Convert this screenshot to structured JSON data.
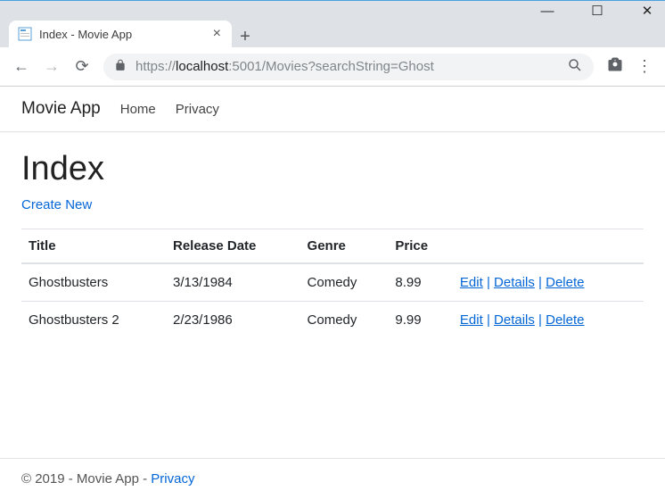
{
  "browser": {
    "tab_title": "Index - Movie App",
    "url_scheme": "https://",
    "url_host": "localhost",
    "url_port": ":5001",
    "url_path": "/Movies?searchString=Ghost"
  },
  "nav": {
    "brand": "Movie App",
    "links": [
      "Home",
      "Privacy"
    ]
  },
  "page": {
    "heading": "Index",
    "create_link": "Create New"
  },
  "table": {
    "headers": [
      "Title",
      "Release Date",
      "Genre",
      "Price",
      ""
    ],
    "rows": [
      {
        "title": "Ghostbusters",
        "release": "3/13/1984",
        "genre": "Comedy",
        "price": "8.99"
      },
      {
        "title": "Ghostbusters 2",
        "release": "2/23/1986",
        "genre": "Comedy",
        "price": "9.99"
      }
    ],
    "actions": {
      "edit": "Edit",
      "details": "Details",
      "delete": "Delete"
    }
  },
  "footer": {
    "text": "© 2019 - Movie App - ",
    "link": "Privacy"
  }
}
